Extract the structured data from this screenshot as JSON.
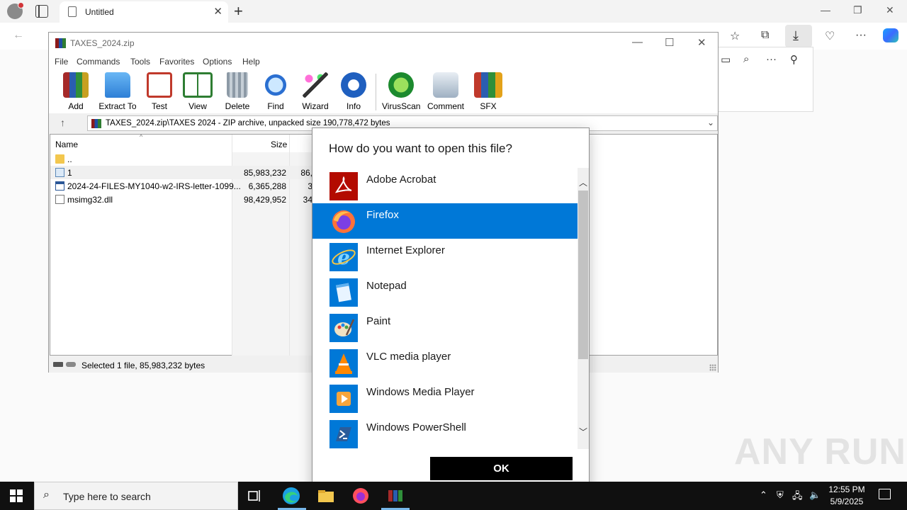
{
  "browser": {
    "tab_title": "Untitled",
    "tab_close": "✕",
    "new_tab": "+",
    "minimize": "—",
    "restore": "❐",
    "close": "✕"
  },
  "winrar": {
    "title": "TAXES_2024.zip",
    "menu": [
      "File",
      "Commands",
      "Tools",
      "Favorites",
      "Options",
      "Help"
    ],
    "tools": [
      "Add",
      "Extract To",
      "Test",
      "View",
      "Delete",
      "Find",
      "Wizard",
      "Info",
      "VirusScan",
      "Comment",
      "SFX"
    ],
    "path": "TAXES_2024.zip\\TAXES 2024 - ZIP archive, unpacked size 190,778,472 bytes",
    "columns": {
      "name": "Name",
      "size": "Size"
    },
    "rows": [
      {
        "name": "..",
        "size": "",
        "packed": "",
        "icon": "folder-up-icon"
      },
      {
        "name": "1",
        "size": "85,983,232",
        "packed": "86,",
        "icon": "file-icon"
      },
      {
        "name": "2024-24-FILES-MY1040-w2-IRS-letter-1099...",
        "size": "6,365,288",
        "packed": "3",
        "icon": "exe-icon"
      },
      {
        "name": "msimg32.dll",
        "size": "98,429,952",
        "packed": "34",
        "icon": "dll-icon"
      }
    ],
    "status": "Selected 1 file, 85,983,232 bytes"
  },
  "dialog": {
    "title": "How do you want to open this file?",
    "apps": [
      {
        "name": "Adobe Acrobat",
        "icon": "adobe-acrobat-icon"
      },
      {
        "name": "Firefox",
        "icon": "firefox-icon"
      },
      {
        "name": "Internet Explorer",
        "icon": "internet-explorer-icon"
      },
      {
        "name": "Notepad",
        "icon": "notepad-icon"
      },
      {
        "name": "Paint",
        "icon": "paint-icon"
      },
      {
        "name": "VLC media player",
        "icon": "vlc-icon"
      },
      {
        "name": "Windows Media Player",
        "icon": "windows-media-player-icon"
      },
      {
        "name": "Windows PowerShell",
        "icon": "powershell-icon"
      }
    ],
    "selected": "Firefox",
    "ok": "OK"
  },
  "taskbar": {
    "search_placeholder": "Type here to search",
    "time": "12:55 PM",
    "date": "5/9/2025"
  },
  "watermark": "ANY RUN",
  "colors": {
    "accent": "#0078d7",
    "taskbar": "#101010"
  }
}
